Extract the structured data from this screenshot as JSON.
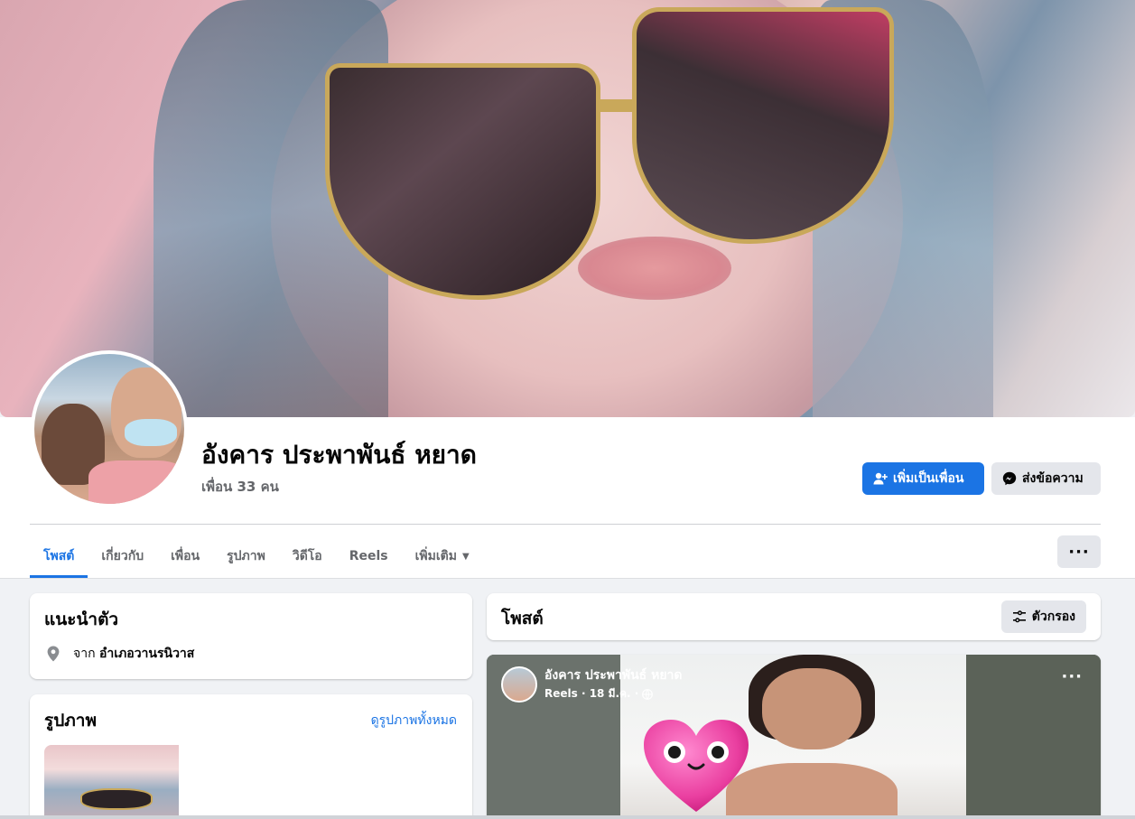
{
  "profile": {
    "name": "อังคาร ประพาพันธ์ หยาด",
    "friends_count": "เพื่อน 33 คน"
  },
  "actions": {
    "add_friend": "เพิ่มเป็นเพื่อน",
    "message": "ส่งข้อความ",
    "more": "···"
  },
  "tabs": [
    {
      "label": "โพสต์",
      "active": true
    },
    {
      "label": "เกี่ยวกับ"
    },
    {
      "label": "เพื่อน"
    },
    {
      "label": "รูปภาพ"
    },
    {
      "label": "วิดีโอ"
    },
    {
      "label": "Reels"
    },
    {
      "label": "เพิ่มเติม"
    }
  ],
  "intro": {
    "title": "แนะนำตัว",
    "from_prefix": "จาก",
    "from_place": "อำเภอวานรนิวาส"
  },
  "photos": {
    "title": "รูปภาพ",
    "see_all": "ดูรูปภาพทั้งหมด"
  },
  "posts": {
    "title": "โพสต์",
    "filter_label": "ตัวกรอง"
  },
  "reel_post": {
    "author": "อังคาร ประพาพันธ์ หยาด",
    "subtitle": "Reels · 18 มี.ค. ·",
    "more": "···"
  },
  "colors": {
    "accent": "#1b74e4",
    "background": "#f0f2f5",
    "secondary_button": "#e4e6eb",
    "muted_text": "#65676b"
  },
  "icons": [
    "add-friend-icon",
    "messenger-icon",
    "location-pin-icon",
    "filter-icon",
    "globe-icon",
    "chevron-down-icon",
    "more-icon"
  ]
}
